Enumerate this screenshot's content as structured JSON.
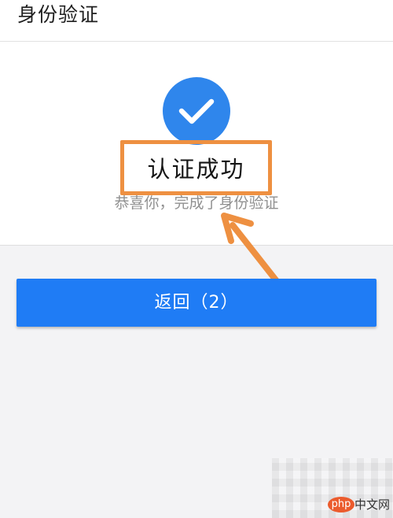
{
  "header": {
    "title": "身份验证"
  },
  "result": {
    "icon": "check-icon",
    "title": "认证成功",
    "subtitle": "恭喜你，完成了身份验证"
  },
  "actions": {
    "back_label": "返回（2）"
  },
  "watermark": {
    "logo_text": "php",
    "site_text": "中文网"
  },
  "colors": {
    "primary": "#1f7cf5",
    "check_circle": "#2f86ec",
    "annotation": "#ee9041",
    "background": "#f3f3f5",
    "panel": "#ffffff"
  }
}
